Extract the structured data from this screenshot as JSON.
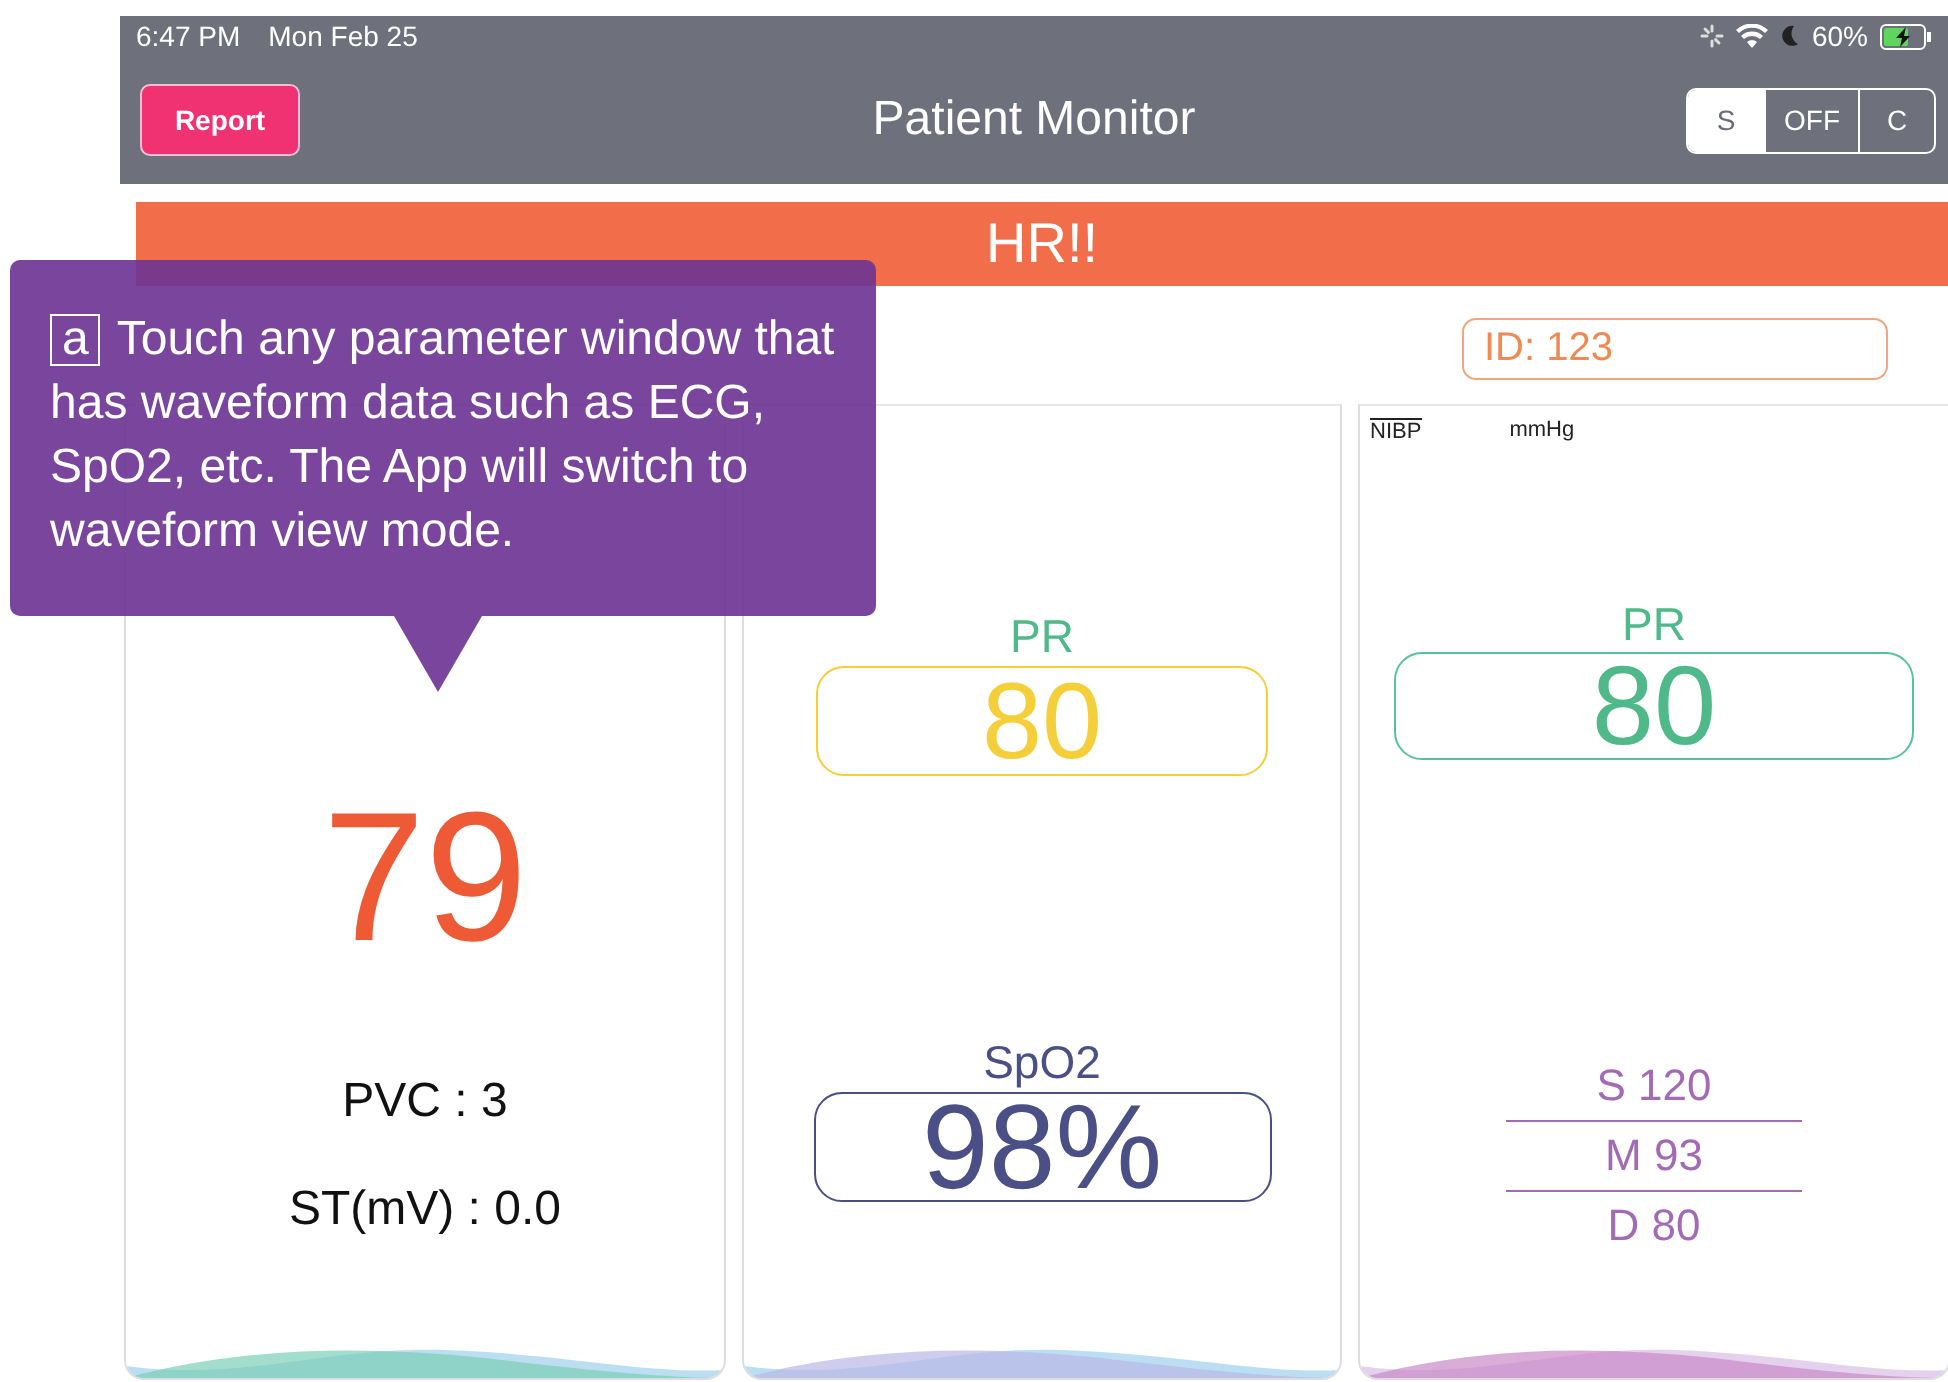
{
  "status_bar": {
    "time": "6:47 PM",
    "date": "Mon Feb 25",
    "battery": "60%",
    "charging": true
  },
  "nav": {
    "title": "Patient Monitor",
    "report_button": "Report",
    "mode_segments": [
      {
        "label": "S",
        "selected": true
      },
      {
        "label": "OFF",
        "selected": false
      },
      {
        "label": "C",
        "selected": false
      }
    ]
  },
  "alarm_banner": "HR!!",
  "patient_id": "ID: 123",
  "panels": [
    {
      "kind": "hr",
      "value": "79",
      "lines": [
        "PVC : 3",
        "ST(mV) : 0.0"
      ]
    },
    {
      "kind": "spo2",
      "boxes": [
        {
          "label": "PR",
          "value": "80",
          "color": "#f5cf3a"
        },
        {
          "label": "SpO2",
          "value": "98%",
          "color": "#4a4f86"
        }
      ]
    },
    {
      "kind": "nibp",
      "name": "NIBP",
      "unit": "mmHg",
      "pr": {
        "label": "PR",
        "value": "80"
      },
      "pressures": [
        "S 120",
        "M 93",
        "D 80"
      ]
    }
  ],
  "tooltip": {
    "marker": "a",
    "text": "Touch any parameter window that has waveform data such as ECG, SpO2, etc. The App will switch to waveform view mode."
  }
}
